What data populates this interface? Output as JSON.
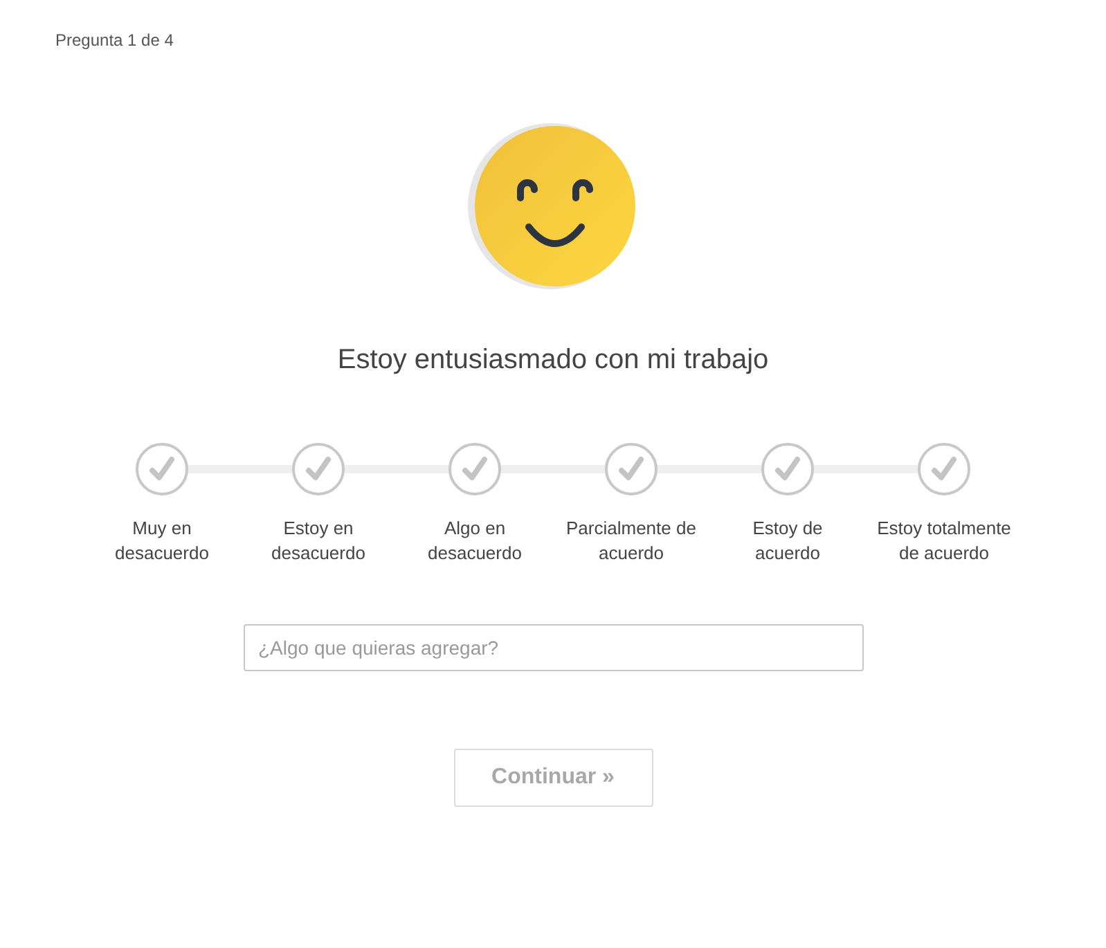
{
  "progress": "Pregunta 1 de 4",
  "question": "Estoy entusiasmado con mi trabajo",
  "options": [
    {
      "label": "Muy en desacuerdo",
      "selected": false
    },
    {
      "label": "Estoy en desacuerdo",
      "selected": false
    },
    {
      "label": "Algo en desacuerdo",
      "selected": false
    },
    {
      "label": "Parcialmente de acuerdo",
      "selected": false
    },
    {
      "label": "Estoy de acuerdo",
      "selected": false
    },
    {
      "label": "Estoy totalmente de acuerdo",
      "selected": false
    }
  ],
  "comment": {
    "placeholder": "¿Algo que quieras agregar?"
  },
  "continue_button": {
    "label": "Continuar »",
    "disabled": true
  }
}
